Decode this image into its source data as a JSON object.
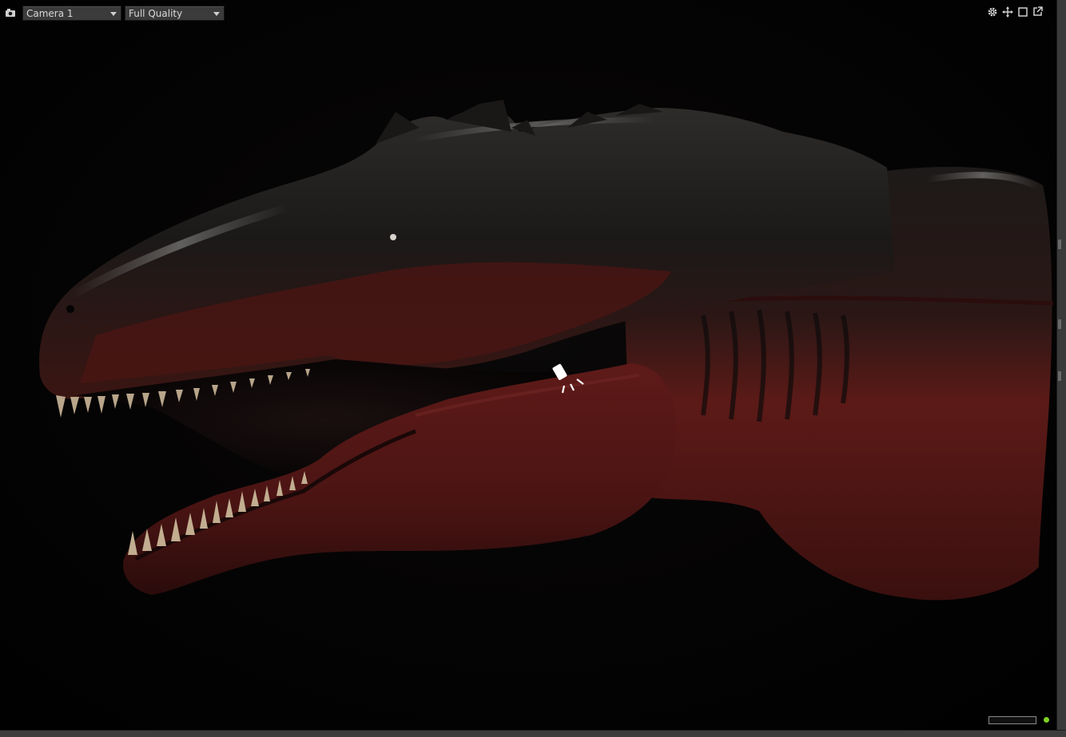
{
  "toolbar": {
    "camera_icon": "camera-icon",
    "camera_select": {
      "value": "Camera 1"
    },
    "quality_select": {
      "value": "Full Quality"
    }
  },
  "top_right_icons": [
    "gear-icon",
    "move-icon",
    "maximize-icon",
    "popout-icon"
  ],
  "viewport": {
    "background": "#020202",
    "subject": "dinosaur-head-render",
    "light_gizmo": "spotlight-icon"
  },
  "status": {
    "progress": 0.0,
    "indicator_color": "#7ed321"
  },
  "colors": {
    "panel": "#3b3b3b",
    "skin_dark": "#1c1a19",
    "skin_red": "#5a1414"
  }
}
